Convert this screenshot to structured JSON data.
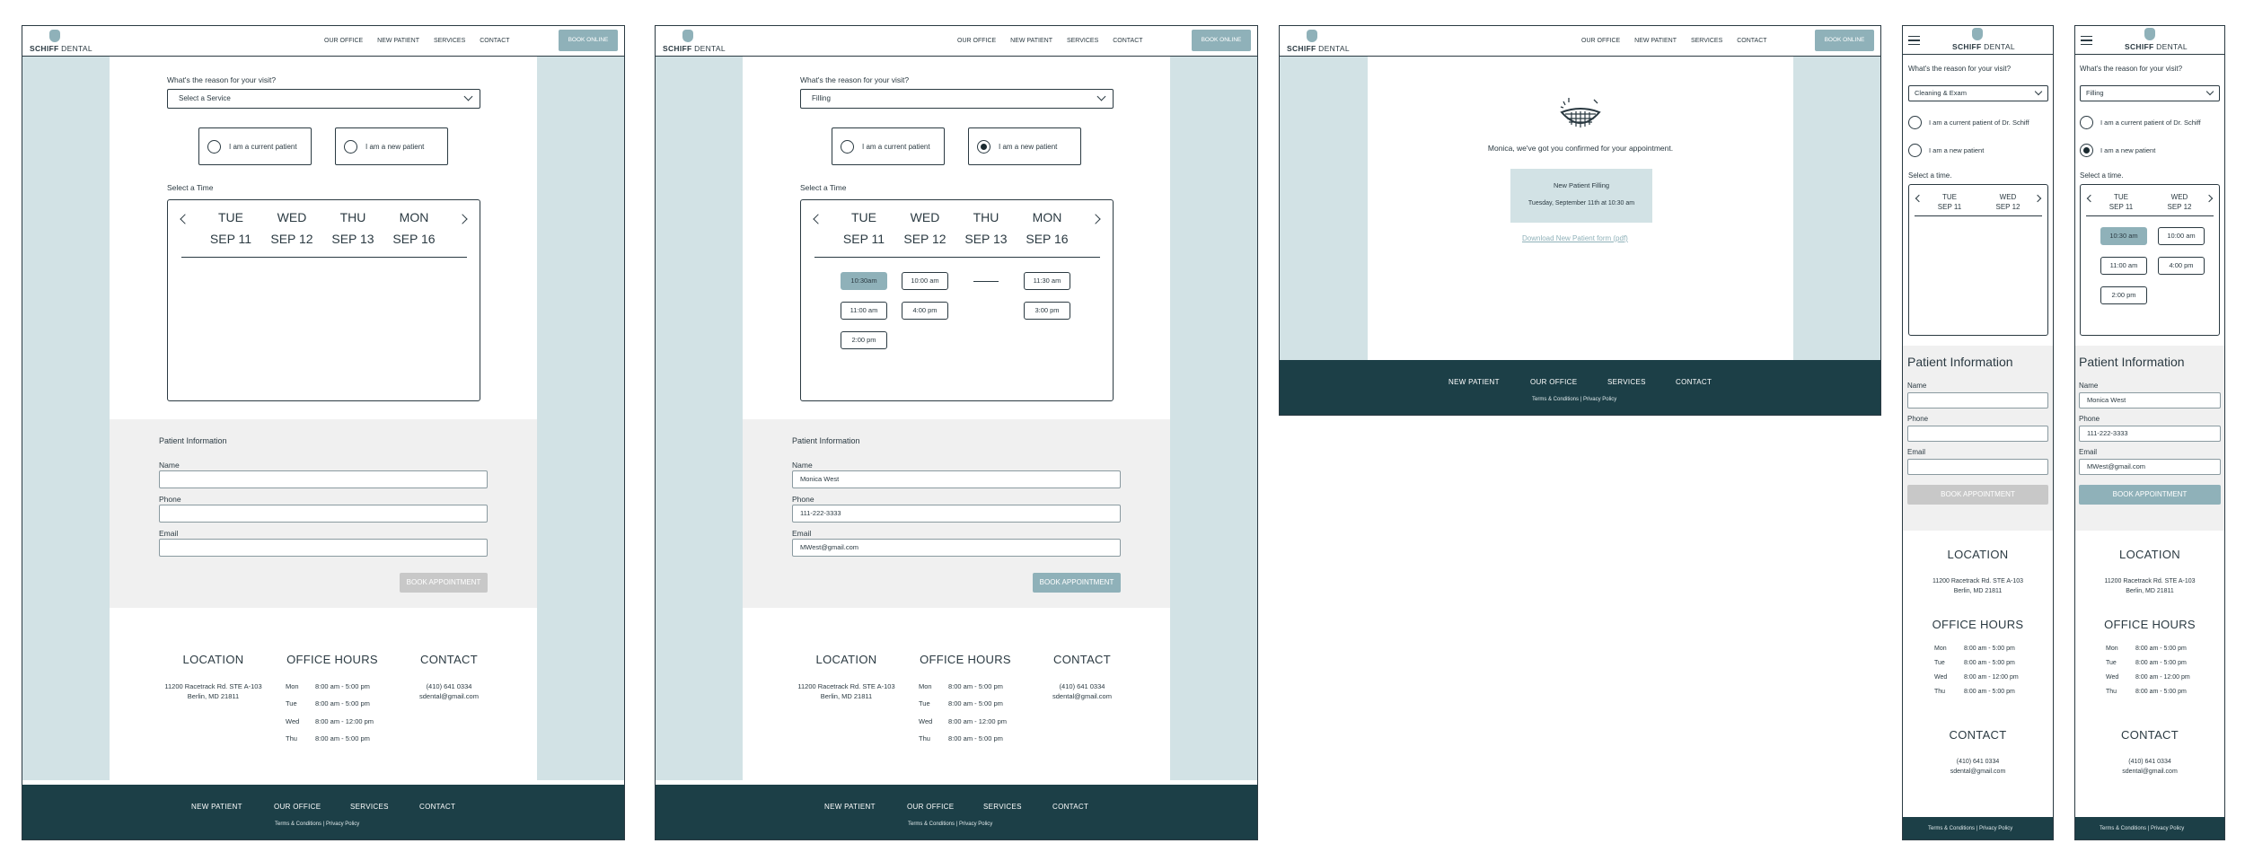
{
  "brand": {
    "name_bold": "SCHIFF",
    "name_rest": " DENTAL"
  },
  "nav": {
    "our_office": "OUR OFFICE",
    "new_patient": "NEW PATIENT",
    "services": "SERVICES",
    "contact": "CONTACT",
    "book_online": "BOOK ONLINE"
  },
  "booking": {
    "reason_label": "What's the reason for your visit?",
    "select_placeholder": "Select a Service",
    "selected_filling": "Filling",
    "selected_cleaning": "Cleaning & Exam",
    "current_patient": "I am a current patient",
    "new_patient": "I am a new patient",
    "current_patient_mobile": "I am a current patient of Dr. Schiff",
    "select_time": "Select a Time",
    "select_time_mobile": "Select a time.",
    "days": [
      {
        "dow": "TUE",
        "date": "SEP 11"
      },
      {
        "dow": "WED",
        "date": "SEP 12"
      },
      {
        "dow": "THU",
        "date": "SEP 13"
      },
      {
        "dow": "MON",
        "date": "SEP 16"
      }
    ],
    "slots": [
      "10:30am",
      "11:00 am",
      "2:00 pm",
      "10:00 am",
      "4:00 pm",
      "11:30 am",
      "3:00 pm"
    ],
    "slots_mobile": [
      "10:30 am",
      "10:00 am",
      "11:00 am",
      "4:00 pm",
      "2:00 pm"
    ]
  },
  "patient": {
    "title": "Patient Information",
    "name_label": "Name",
    "phone_label": "Phone",
    "email_label": "Email",
    "name_value": "Monica West",
    "phone_value": "111-222-3333",
    "email_value": "MWest@gmail.com",
    "book_button": "BOOK APPOINTMENT"
  },
  "confirmation": {
    "message": "Monica, we've got you confirmed for your appointment.",
    "appt_title": "New Patient Filling",
    "appt_time": "Tuesday, September 11th at 10:30 am",
    "download_link": "Download New Patient form (pdf)"
  },
  "footer": {
    "location_title": "LOCATION",
    "address1": "11200 Racetrack Rd. STE A-103",
    "address2": "Berlin, MD 21811",
    "hours_title": "OFFICE HOURS",
    "hours": [
      {
        "day": "Mon",
        "time": "8:00 am - 5:00 pm"
      },
      {
        "day": "Tue",
        "time": "8:00 am - 5:00 pm"
      },
      {
        "day": "Wed",
        "time": "8:00 am - 12:00 pm"
      },
      {
        "day": "Thu",
        "time": "8:00 am - 5:00 pm"
      }
    ],
    "contact_title": "CONTACT",
    "phone": "(410) 641 0334",
    "email": "sdental@gmail.com",
    "terms": "Terms & Conditions",
    "privacy": "Privacy Policy",
    "nav": [
      "NEW PATIENT",
      "OUR OFFICE",
      "SERVICES",
      "CONTACT"
    ]
  },
  "colors": {
    "accent": "#8fb1b9",
    "sidebar": "#d2e2e5",
    "footer": "#1c3f47",
    "text": "#2b3a42"
  }
}
